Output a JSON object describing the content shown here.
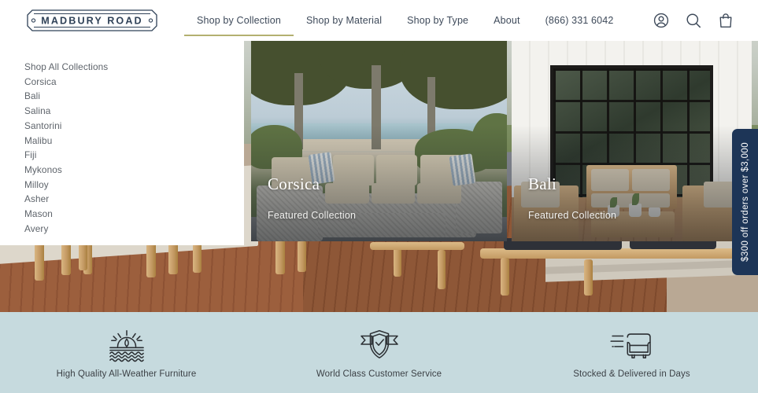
{
  "brand": {
    "name": "MADBURY ROAD",
    "logo_icon": "street-sign-plaque"
  },
  "header": {
    "nav": [
      {
        "label": "Shop by Collection",
        "active": true
      },
      {
        "label": "Shop by Material",
        "active": false
      },
      {
        "label": "Shop by Type",
        "active": false
      },
      {
        "label": "About",
        "active": false
      },
      {
        "label": "(866) 331 6042",
        "active": false
      }
    ],
    "icons": [
      {
        "name": "account-icon",
        "label": "Account"
      },
      {
        "name": "search-icon",
        "label": "Search"
      },
      {
        "name": "shopping-bag-icon",
        "label": "Cart"
      }
    ],
    "active_underline_color": "#b3b070"
  },
  "dropdown": {
    "links": [
      "Shop All Collections",
      "Corsica",
      "Bali",
      "Salina",
      "Santorini",
      "Malibu",
      "Fiji",
      "Mykonos",
      "Milloy",
      "Asher",
      "Mason",
      "Avery"
    ],
    "cards": [
      {
        "title": "Corsica",
        "subtitle": "Featured Collection",
        "image_alt": "Gray wicker sectional sofa on a lakeside stone patio"
      },
      {
        "title": "Bali",
        "subtitle": "Featured Collection",
        "image_alt": "Teak sofa and armchairs on a wood deck by black-framed glass doors"
      }
    ]
  },
  "promo": {
    "text": "$300 off orders over $3,000",
    "background_color": "#1d3557"
  },
  "hero": {
    "image_alt": "Teak outdoor furniture on a composite wood deck with lawn"
  },
  "trust_bar": {
    "background_color": "#c6dade",
    "items": [
      {
        "icon": "sun-over-waves-icon",
        "label": "High Quality All-Weather Furniture"
      },
      {
        "icon": "shield-check-ribbon-icon",
        "label": "World Class Customer Service"
      },
      {
        "icon": "armchair-speed-icon",
        "label": "Stocked & Delivered in Days"
      }
    ]
  }
}
